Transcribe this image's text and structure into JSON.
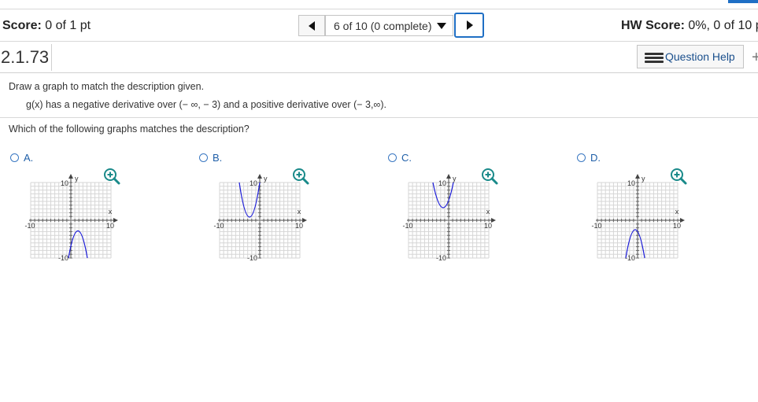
{
  "header": {
    "score_label": "Score:",
    "score_value": "0 of 1 pt",
    "nav_label": "6 of 10 (0 complete)",
    "hw_score_label": "HW Score:",
    "hw_score_value": "0%, 0 of 10 p"
  },
  "question": {
    "id": "2.1.73",
    "help_label": "Question Help",
    "instruction": "Draw a graph to match the description given.",
    "description": "g(x) has a negative derivative over (− ∞, − 3) and a positive derivative over (− 3,∞).",
    "prompt": "Which of the following graphs matches the description?"
  },
  "choices": [
    {
      "label": "A.",
      "icon": "zoom-in-icon"
    },
    {
      "label": "B.",
      "icon": "zoom-in-icon"
    },
    {
      "label": "C.",
      "icon": "zoom-in-icon"
    },
    {
      "label": "D.",
      "icon": "zoom-in-icon"
    }
  ],
  "graph_labels": {
    "y_axis": "y",
    "x_axis": "x",
    "y_max": "10",
    "y_min": "-10",
    "x_min": "-10",
    "x_max": "10"
  },
  "colors": {
    "accent": "#1f6fc5",
    "curve": "#1a1ad8",
    "grid": "#d6d6d6",
    "zoom_icon": "#1a8a8a"
  }
}
